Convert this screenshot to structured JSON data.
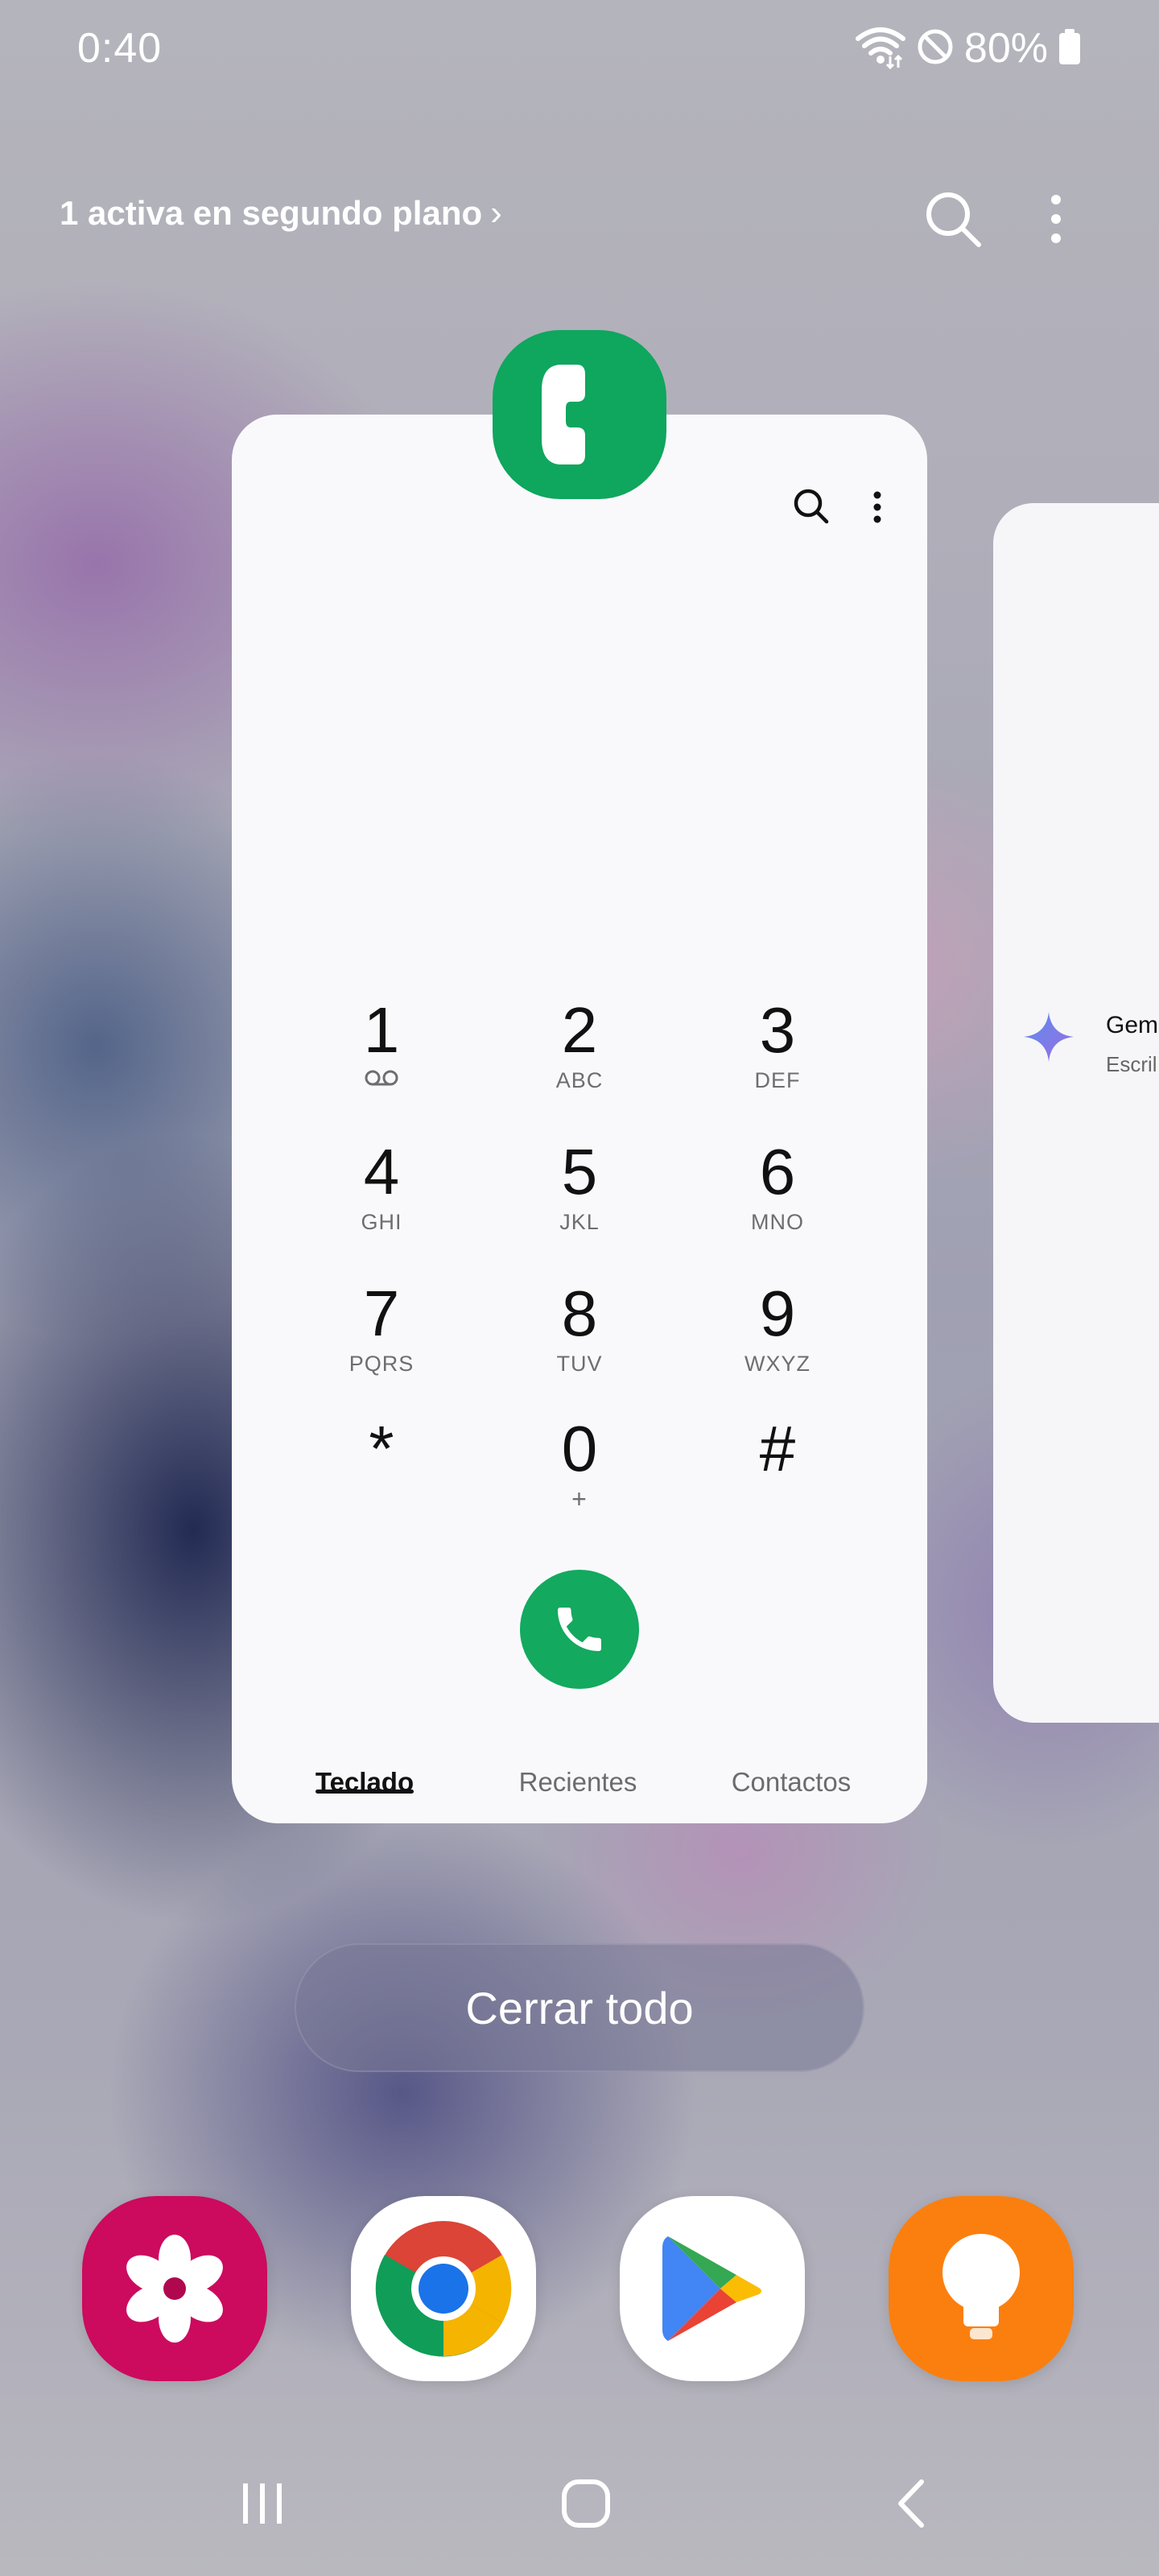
{
  "status_bar": {
    "time": "0:40",
    "battery_percent": "80%",
    "icons": [
      "wifi-data-icon",
      "do-not-disturb-icon",
      "battery-icon"
    ]
  },
  "header": {
    "background_active_label": "1 activa en segundo plano",
    "chevron": "›",
    "search_icon": "search-icon",
    "more_icon": "more-vert-icon"
  },
  "phone_card": {
    "app_icon": "phone-app-icon",
    "keys": [
      {
        "digit": "1",
        "sub": "voicemail"
      },
      {
        "digit": "2",
        "sub": "ABC"
      },
      {
        "digit": "3",
        "sub": "DEF"
      },
      {
        "digit": "4",
        "sub": "GHI"
      },
      {
        "digit": "5",
        "sub": "JKL"
      },
      {
        "digit": "6",
        "sub": "MNO"
      },
      {
        "digit": "7",
        "sub": "PQRS"
      },
      {
        "digit": "8",
        "sub": "TUV"
      },
      {
        "digit": "9",
        "sub": "WXYZ"
      },
      {
        "digit": "*",
        "sub": ""
      },
      {
        "digit": "0",
        "sub": "+"
      },
      {
        "digit": "#",
        "sub": ""
      }
    ],
    "tabs": [
      "Teclado",
      "Recientes",
      "Contactos"
    ],
    "active_tab": "Teclado",
    "accent_color": "#13a95f"
  },
  "next_card": {
    "title": "Gem",
    "subtitle": "Escril"
  },
  "close_all_label": "Cerrar todo",
  "dock": [
    "blossom-app-icon",
    "chrome-icon",
    "play-store-icon",
    "tips-lightbulb-icon"
  ],
  "nav": [
    "recents-nav-icon",
    "home-nav-icon",
    "back-nav-icon"
  ]
}
